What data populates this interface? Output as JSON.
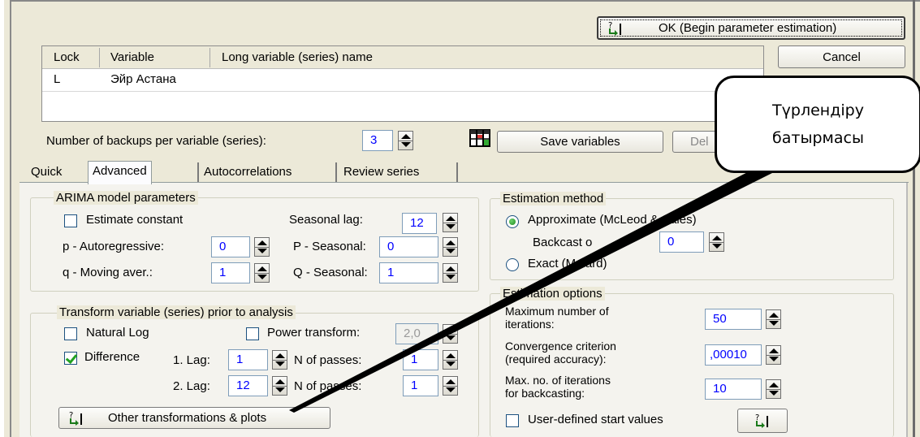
{
  "buttons": {
    "ok": "OK (Begin parameter estimation)",
    "cancel": "Cancel",
    "save_variables": "Save variables",
    "delete_partial": "Del",
    "other_transformations": "Other transformations & plots"
  },
  "grid": {
    "headers": [
      "Lock",
      "Variable",
      "Long variable (series) name"
    ],
    "rows": [
      [
        "L",
        "Эйр Астана",
        ""
      ]
    ]
  },
  "backups": {
    "label": "Number of backups per variable (series):",
    "value": "3"
  },
  "tabs": [
    "Quick",
    "Advanced",
    "Autocorrelations",
    "Review series"
  ],
  "arima": {
    "title": "ARIMA model parameters",
    "estimate_constant": {
      "label": "Estimate constant",
      "checked": false
    },
    "seasonal_lag": {
      "label": "Seasonal lag:",
      "value": "12"
    },
    "p": {
      "label": "p - Autoregressive:",
      "value": "0"
    },
    "P": {
      "label": "P - Seasonal:",
      "value": "0"
    },
    "q": {
      "label": "q - Moving aver.:",
      "value": "1"
    },
    "Q": {
      "label": "Q - Seasonal:",
      "value": "1"
    }
  },
  "transform": {
    "title": "Transform variable (series) prior to analysis",
    "natural_log": {
      "label": "Natural Log",
      "checked": false
    },
    "power_transform": {
      "label": "Power transform:",
      "value": "2,0",
      "checked": false
    },
    "difference": {
      "label": "Difference",
      "checked": true
    },
    "lag1": {
      "label": "1. Lag:",
      "value": "1",
      "passes_label": "N of passes:",
      "passes": "1"
    },
    "lag2": {
      "label": "2. Lag:",
      "value": "12",
      "passes_label": "N of passes:",
      "passes": "1"
    }
  },
  "estimation_method": {
    "title": "Estimation method",
    "approximate": "Approximate (McLeod & Sales)",
    "backcast_label": "Backcast o",
    "backcast_value": "0",
    "exact": "Exact (Melard)",
    "selected": "approximate"
  },
  "estimation_options": {
    "title": "Estimation options",
    "max_iterations": {
      "label1": "Maximum number of",
      "label2": "iterations:",
      "value": "50"
    },
    "convergence": {
      "label1": "Convergence criterion",
      "label2": "(required accuracy):",
      "value": ",00010"
    },
    "backcast_iterations": {
      "label1": "Max. no. of iterations",
      "label2": "for backcasting:",
      "value": "10"
    },
    "user_defined": {
      "label": "User-defined start values",
      "checked": false
    }
  },
  "callout": {
    "line1": "Түрлендіру",
    "line2": "батырмасы"
  },
  "colors": {
    "dialog_bg": "#ece9d8",
    "panel_bg": "#f4f3ee",
    "field_text": "#0000ff",
    "check_green": "#21a121"
  },
  "icons": [
    "grid-save-icon",
    "run-arrow-icon"
  ]
}
